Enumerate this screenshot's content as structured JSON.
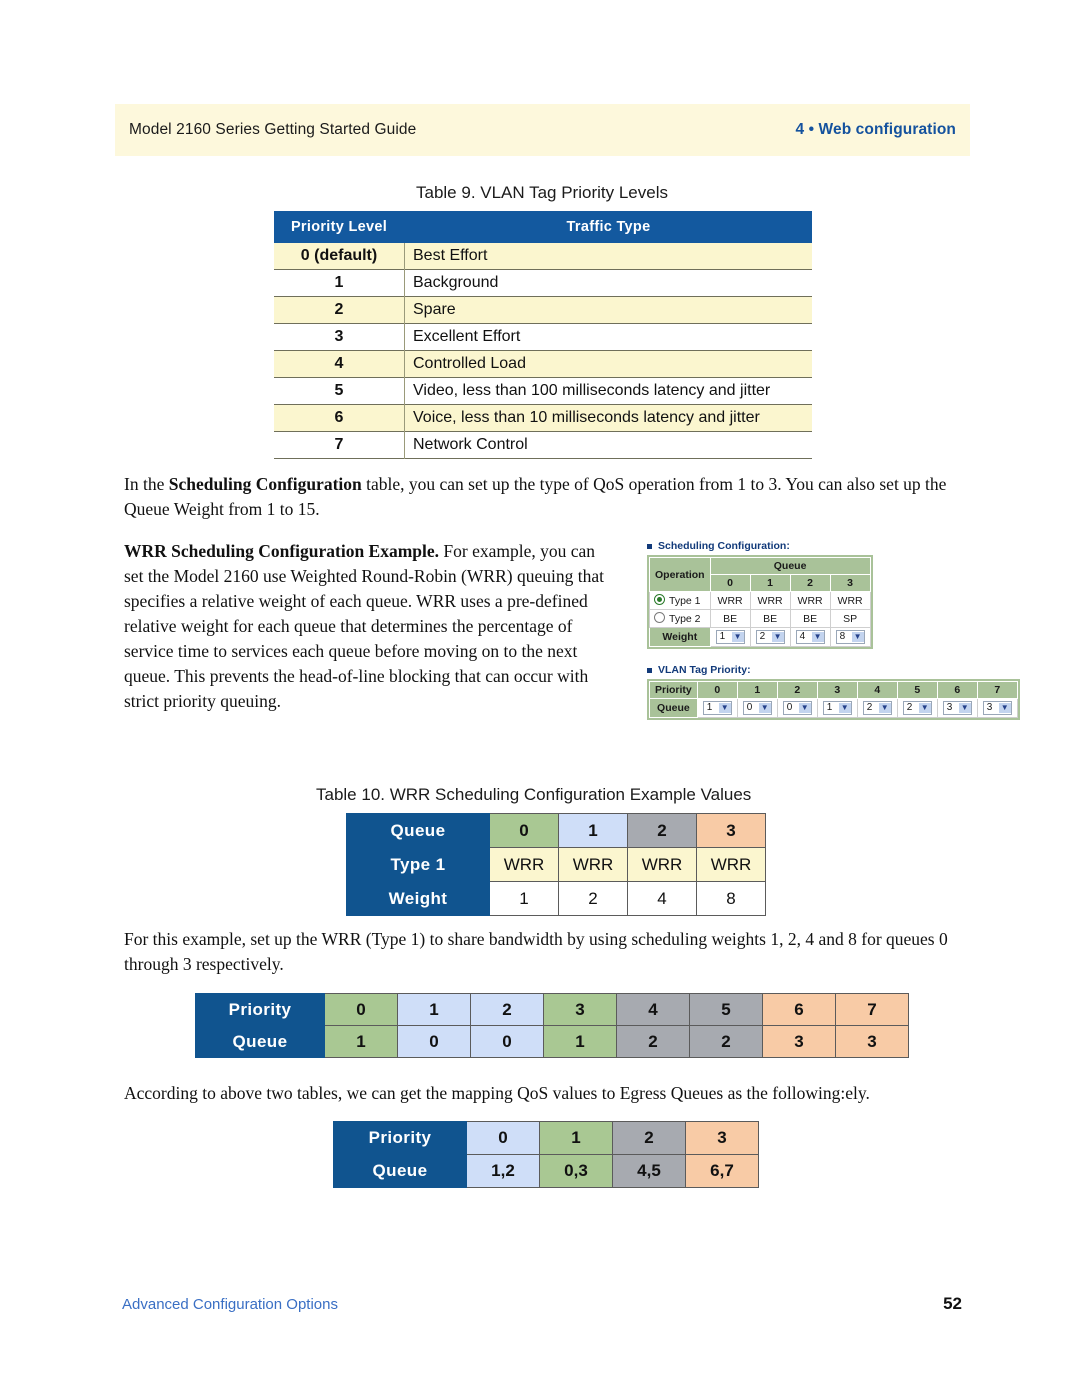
{
  "header": {
    "left": "Model 2160 Series Getting Started Guide",
    "right": "4 • Web configuration"
  },
  "table9": {
    "caption": "Table 9. VLAN Tag Priority Levels",
    "columns": [
      "Priority Level",
      "Traffic Type"
    ],
    "rows": [
      {
        "level": "0 (default)",
        "type": "Best Effort"
      },
      {
        "level": "1",
        "type": "Background"
      },
      {
        "level": "2",
        "type": "Spare"
      },
      {
        "level": "3",
        "type": "Excellent Effort"
      },
      {
        "level": "4",
        "type": "Controlled Load"
      },
      {
        "level": "5",
        "type": "Video, less than 100 milliseconds latency and jitter"
      },
      {
        "level": "6",
        "type": "Voice, less than 10 milliseconds latency and jitter"
      },
      {
        "level": "7",
        "type": "Network Control"
      }
    ]
  },
  "paragraphs": {
    "p1_a": "In the ",
    "p1_b": "Scheduling Configuration",
    "p1_c": " table, you can set up the type of QoS operation from 1 to 3. You can also set up the Queue Weight from 1 to 15.",
    "p2_b": "WRR Scheduling Configuration Example.",
    "p2_c": " For example, you can set the Model 2160 use Weighted Round-Robin (WRR) queuing that specifies a relative weight of each queue. WRR uses a pre-defined relative weight for each queue that determines the percentage of service time to services each queue before moving on to the next queue. This prevents the head-of-line blocking that can occur with strict priority queuing.",
    "p3": "For this example, set up the WRR (Type 1) to share bandwidth by using scheduling weights 1, 2, 4 and 8 for queues 0 through 3 respectively.",
    "p4": "According to above two tables, we can get the mapping QoS values to Egress Queues as the following:ely."
  },
  "screenshot": {
    "sched": {
      "label": "Scheduling Configuration:",
      "operation_header": "Operation",
      "queue_header": "Queue",
      "queue_numbers": [
        "0",
        "1",
        "2",
        "3"
      ],
      "type1_label": "Type 1",
      "type1_selected": true,
      "type1_values": [
        "WRR",
        "WRR",
        "WRR",
        "WRR"
      ],
      "type2_label": "Type 2",
      "type2_selected": false,
      "type2_values": [
        "BE",
        "BE",
        "BE",
        "SP"
      ],
      "weight_label": "Weight",
      "weight_values": [
        "1",
        "2",
        "4",
        "8"
      ]
    },
    "vlan": {
      "label": "VLAN Tag Priority:",
      "priority_label": "Priority",
      "priority_values": [
        "0",
        "1",
        "2",
        "3",
        "4",
        "5",
        "6",
        "7"
      ],
      "queue_label": "Queue",
      "queue_values": [
        "1",
        "0",
        "0",
        "1",
        "2",
        "2",
        "3",
        "3"
      ]
    }
  },
  "table10": {
    "caption": "Table 10. WRR Scheduling Configuration Example Values",
    "row_headers": [
      "Queue",
      "Type 1",
      "Weight"
    ],
    "queue": [
      "0",
      "1",
      "2",
      "3"
    ],
    "queue_colors": [
      "#a9c893",
      "#cfdef8",
      "#a7aab0",
      "#f8cba6"
    ],
    "type1": [
      "WRR",
      "WRR",
      "WRR",
      "WRR"
    ],
    "weight": [
      "1",
      "2",
      "4",
      "8"
    ]
  },
  "priority_table": {
    "row_headers": [
      "Priority",
      "Queue"
    ],
    "priority": [
      "0",
      "1",
      "2",
      "3",
      "4",
      "5",
      "6",
      "7"
    ],
    "queue": [
      "1",
      "0",
      "0",
      "1",
      "2",
      "2",
      "3",
      "3"
    ],
    "colors": [
      "#a9c893",
      "#cfdef8",
      "#cfdef8",
      "#a9c893",
      "#a7aab0",
      "#a7aab0",
      "#f8cba6",
      "#f8cba6"
    ]
  },
  "mapping_table": {
    "row_headers": [
      "Priority",
      "Queue"
    ],
    "priority": [
      "0",
      "1",
      "2",
      "3"
    ],
    "queue": [
      "1,2",
      "0,3",
      "4,5",
      "6,7"
    ],
    "colors": [
      "#cfdef8",
      "#a9c893",
      "#a7aab0",
      "#f8cba6"
    ]
  },
  "footer": {
    "left": "Advanced Configuration Options",
    "page": "52"
  },
  "colors": {
    "header_band": "#fdf8dc",
    "brand_blue": "#14529e",
    "table_header_blue": "#13599f",
    "row_cream": "#fbf6cf"
  }
}
